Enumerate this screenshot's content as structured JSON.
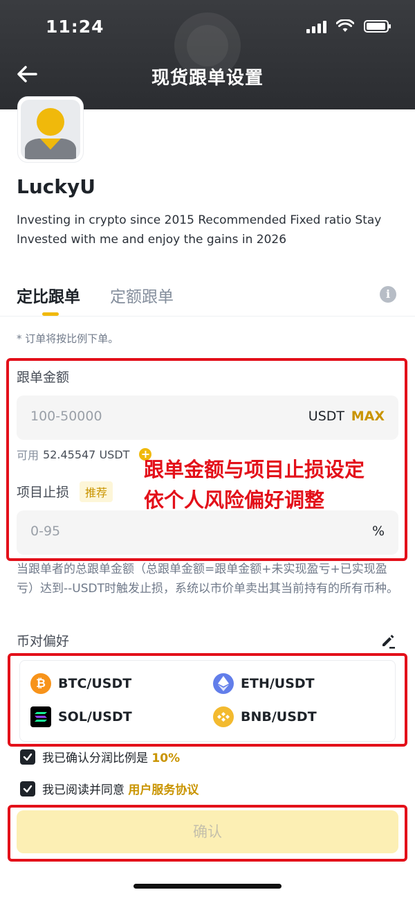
{
  "status_bar": {
    "time": "11:24"
  },
  "header": {
    "title": "现货跟单设置"
  },
  "profile": {
    "name": "LuckyU",
    "bio": "Investing in crypto since 2015 Recommended Fixed ratio Stay Invested with me and enjoy the gains in 2026"
  },
  "tabs": [
    {
      "label": "定比跟单",
      "active": true
    },
    {
      "label": "定额跟单",
      "active": false
    }
  ],
  "note": "* 订单将按比例下单。",
  "amount": {
    "label": "跟单金额",
    "placeholder": "100-50000",
    "unit": "USDT",
    "max_label": "MAX",
    "available_label": "可用",
    "available_value": "52.45547 USDT"
  },
  "stop_loss": {
    "label": "项目止损",
    "badge": "推荐",
    "placeholder": "0-95",
    "unit": "%"
  },
  "annotation": {
    "line1": "跟单金额与项目止损设定",
    "line2": "依个人风险偏好调整"
  },
  "stop_loss_desc": "当跟单者的总跟单金额（总跟单金额=跟单金额+未实现盈亏+已实现盈亏）达到--USDT时触发止损，系统以市价单卖出其当前持有的所有币种。",
  "pair_pref": {
    "label": "币对偏好",
    "pairs": [
      {
        "label": "BTC/USDT",
        "icon": "bitcoin-icon",
        "color": "#f7931a"
      },
      {
        "label": "ETH/USDT",
        "icon": "ethereum-icon",
        "color": "#627eea"
      },
      {
        "label": "SOL/USDT",
        "icon": "solana-icon",
        "color": "#000000"
      },
      {
        "label": "BNB/USDT",
        "icon": "bnb-icon",
        "color": "#f3ba2f"
      }
    ]
  },
  "agreements": {
    "ratio_text": "我已确认分润比例是",
    "ratio_value": "10%",
    "terms_text": "我已阅读并同意",
    "terms_link": "用户服务协议"
  },
  "confirm_label": "确认",
  "colors": {
    "accent": "#f0b90b",
    "annotation_red": "#e3101a",
    "header_bg": "#2b2d31"
  }
}
